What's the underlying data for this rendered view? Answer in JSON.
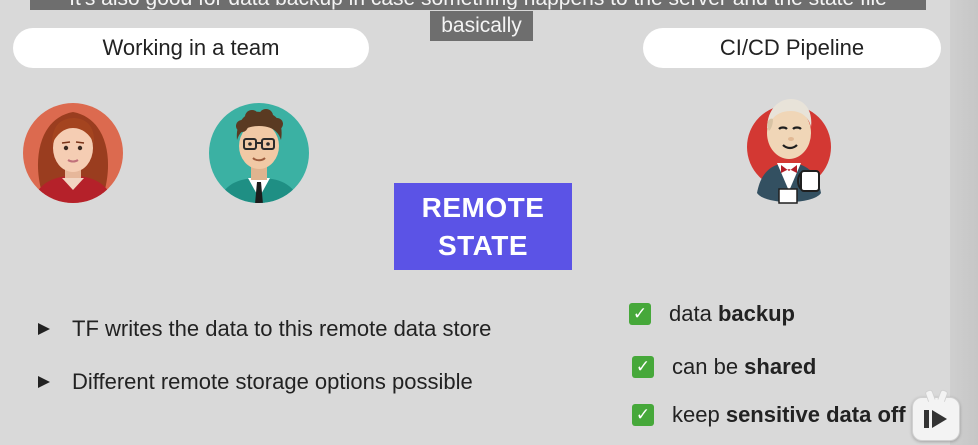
{
  "subtitle": {
    "line1": "It's also good for data backup in case something happens to the server and the state file",
    "line2": "basically"
  },
  "left_panel": {
    "pill_label": "Working in a team"
  },
  "right_panel": {
    "pill_label": "CI/CD Pipeline"
  },
  "center": {
    "box_line1": "REMOTE",
    "box_line2": "STATE"
  },
  "bullets": [
    {
      "text": "TF writes the data to this remote data store"
    },
    {
      "text": "Different remote storage options possible"
    }
  ],
  "checks": [
    {
      "prefix": "data ",
      "bold": "backup"
    },
    {
      "prefix": "can be ",
      "bold": "shared"
    },
    {
      "prefix": "keep ",
      "bold": "sensitive data off disk"
    }
  ],
  "colors": {
    "background": "#d9d9d9",
    "remote_box": "#5b53e6",
    "check_green": "#46a83a",
    "subtitle_bg": "#5f5f5f"
  },
  "icons": {
    "woman_avatar": "woman-avatar-icon",
    "man_avatar": "man-avatar-icon",
    "jenkins": "jenkins-butler-icon",
    "bullet": "triangle-bullet-icon",
    "check": "green-checkmark-icon",
    "player": "play-badge-icon"
  }
}
